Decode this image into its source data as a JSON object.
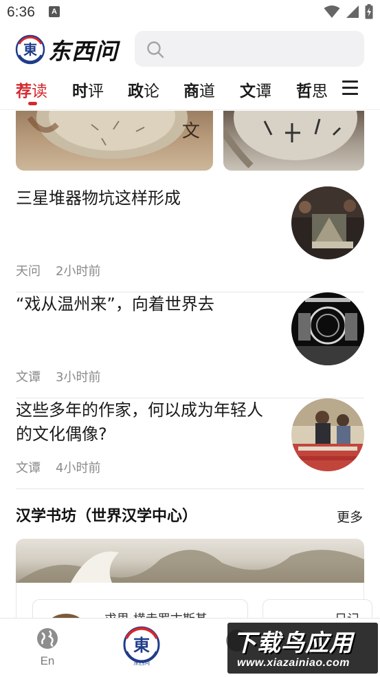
{
  "status_bar": {
    "time": "6:36",
    "notification_glyph": "A",
    "icons": [
      "wifi-icon",
      "signal-icon",
      "battery-charging-icon"
    ]
  },
  "header": {
    "logo_text": "东西问",
    "logo_badge": "東",
    "logo_sub": "东西问",
    "search_icon": "search-icon",
    "search_placeholder": ""
  },
  "tabs": [
    {
      "first": "荐",
      "rest": "读",
      "active": true
    },
    {
      "first": "时",
      "rest": "评",
      "active": false
    },
    {
      "first": "政",
      "rest": "论",
      "active": false
    },
    {
      "first": "商",
      "rest": "道",
      "active": false
    },
    {
      "first": "文",
      "rest": "谭",
      "active": false
    },
    {
      "first": "哲",
      "rest": "思",
      "active": false
    }
  ],
  "top_images": {
    "right_mark": "文"
  },
  "articles": [
    {
      "title": "三星堆器物坑这样形成",
      "source": "天问",
      "time": "2小时前"
    },
    {
      "title": "“戏从温州来”，向着世界去",
      "source": "文谭",
      "time": "3小时前"
    },
    {
      "title": "这些多年的作家，何以成为年轻人的文化偶像?",
      "source": "文谭",
      "time": "4小时前"
    }
  ],
  "section": {
    "title": "汉学书坊（世界汉学中心）",
    "more": "更多",
    "cards": [
      {
        "text": "求思 横走罗古斯基"
      },
      {
        "text": "日记"
      }
    ]
  },
  "bottom_nav": {
    "en_label": "En",
    "center_badge": "東",
    "center_sub": "东西问"
  },
  "watermark": {
    "main": "下载鸟应用",
    "sub": "www.xiazainiao.com"
  },
  "colors": {
    "accent": "#d5292f",
    "logo_blue": "#1f3c8a",
    "meta_gray": "#8a8a8a"
  }
}
